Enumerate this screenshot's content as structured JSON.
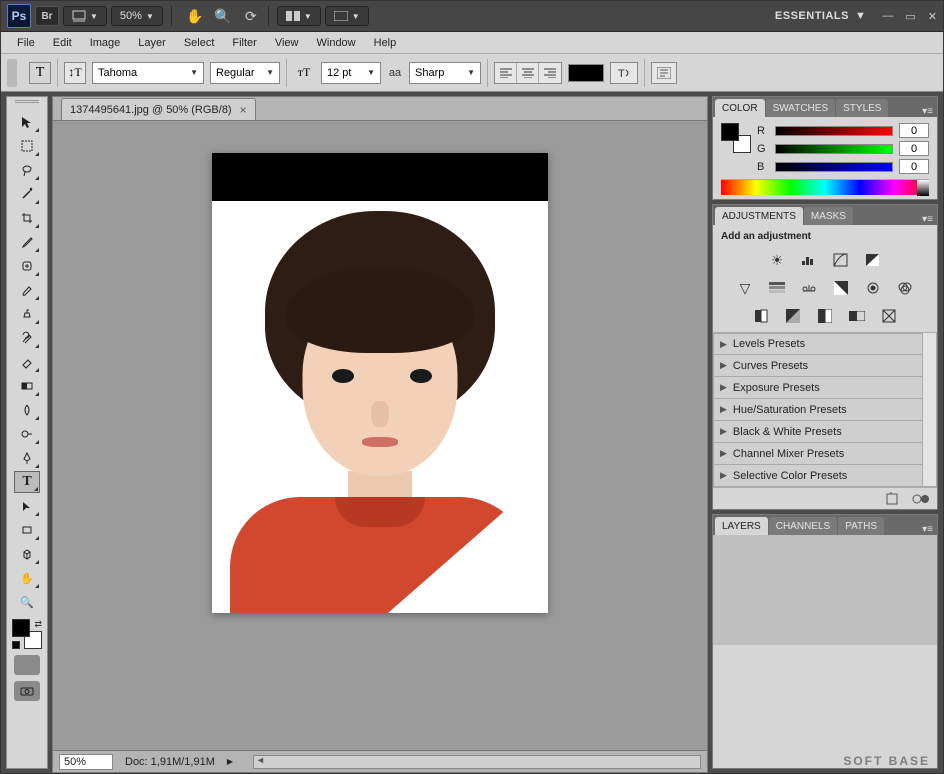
{
  "appbar": {
    "ps_label": "Ps",
    "br_label": "Br",
    "zoom_label": "50%",
    "workspace_label": "ESSENTIALS"
  },
  "menu": {
    "items": [
      "File",
      "Edit",
      "Image",
      "Layer",
      "Select",
      "Filter",
      "View",
      "Window",
      "Help"
    ]
  },
  "optbar": {
    "font_family": "Tahoma",
    "font_style": "Regular",
    "font_size": "12 pt",
    "aa_label": "Sharp",
    "aa_prefix": "aa"
  },
  "document": {
    "tab_title": "1374495641.jpg @ 50% (RGB/8)",
    "status_zoom": "50%",
    "status_doc": "Doc: 1,91M/1,91M"
  },
  "panels": {
    "color": {
      "tabs": [
        "COLOR",
        "SWATCHES",
        "STYLES"
      ],
      "channels": [
        {
          "label": "R",
          "value": "0"
        },
        {
          "label": "G",
          "value": "0"
        },
        {
          "label": "B",
          "value": "0"
        }
      ]
    },
    "adjustments": {
      "tabs": [
        "ADJUSTMENTS",
        "MASKS"
      ],
      "title": "Add an adjustment",
      "presets": [
        "Levels Presets",
        "Curves Presets",
        "Exposure Presets",
        "Hue/Saturation Presets",
        "Black & White Presets",
        "Channel Mixer Presets",
        "Selective Color Presets"
      ]
    },
    "layers": {
      "tabs": [
        "LAYERS",
        "CHANNELS",
        "PATHS"
      ]
    }
  },
  "watermark": "SOFT BASE"
}
